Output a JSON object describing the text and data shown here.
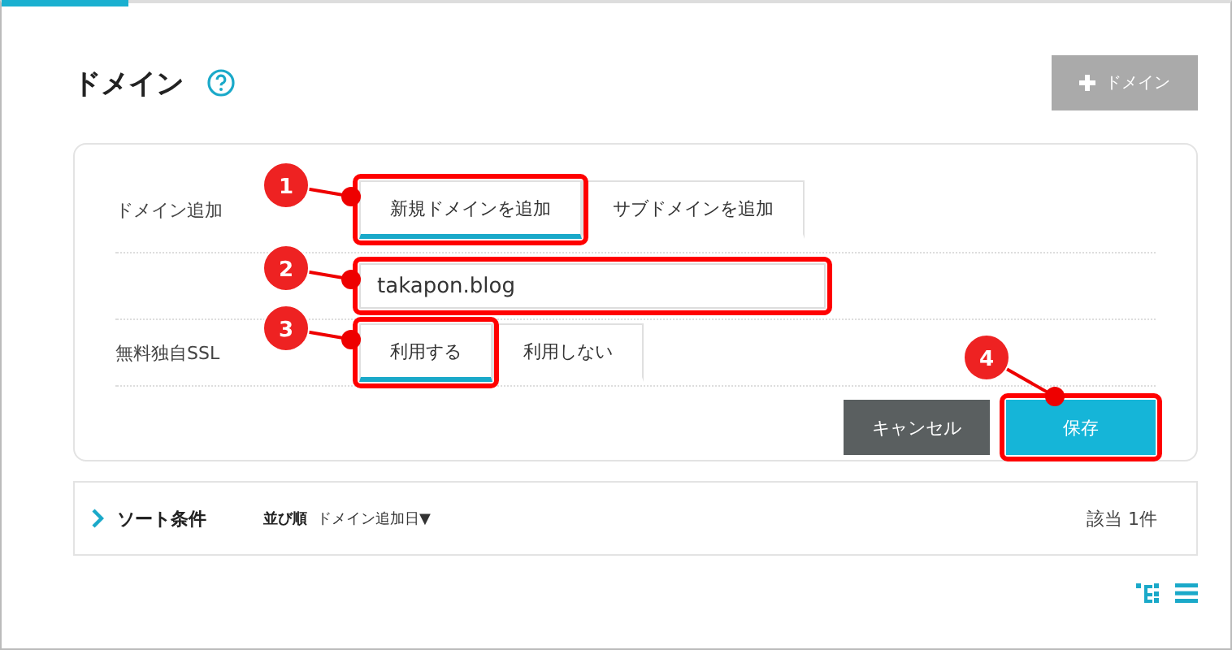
{
  "header": {
    "title": "ドメイン",
    "add_button": "ドメイン"
  },
  "form": {
    "rows": [
      {
        "kind": "toggle",
        "label": "ドメイン追加",
        "options": [
          {
            "label": "新規ドメインを追加",
            "selected": true,
            "callout": {
              "number": "1",
              "kind": "left"
            }
          },
          {
            "label": "サブドメインを追加",
            "selected": false
          }
        ]
      },
      {
        "kind": "input",
        "value": "takapon.blog",
        "callout": {
          "number": "2",
          "kind": "left"
        }
      },
      {
        "kind": "toggle",
        "label": "無料独自SSL",
        "options": [
          {
            "label": "利用する",
            "selected": true,
            "callout": {
              "number": "3",
              "kind": "left"
            }
          },
          {
            "label": "利用しない",
            "selected": false
          }
        ]
      }
    ],
    "cancel": "キャンセル",
    "save": {
      "label": "保存",
      "callout": {
        "number": "4",
        "kind": "top"
      }
    }
  },
  "sort_bar": {
    "title": "ソート条件",
    "order_label": "並び順",
    "order_value": "ドメイン追加日▼",
    "count": "該当 1件"
  }
}
